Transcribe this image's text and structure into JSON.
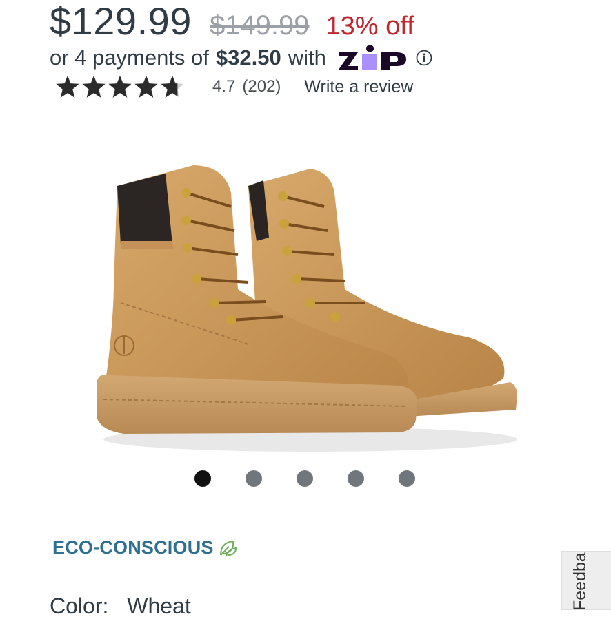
{
  "price": {
    "current": "$129.99",
    "original": "$149.99",
    "discount": "13% off"
  },
  "zip": {
    "prefix": "or 4 payments of",
    "amount": "$32.50",
    "suffix": "with",
    "logo_text": "ZIP",
    "brand_color": "#1a0826",
    "accent_color": "#aa8fff",
    "info_icon": "info-circle-icon"
  },
  "rating": {
    "stars": 4.7,
    "value": "4.7",
    "count": "(202)",
    "review_link": "Write a review"
  },
  "gallery": {
    "image_icon": "wheat-work-boots-image",
    "dot_count": 5,
    "active_index": 0
  },
  "eco": {
    "label": "ECO-CONSCIOUS",
    "icon": "leaf-icon",
    "color": "#2f6f8f"
  },
  "color": {
    "label": "Color:",
    "value": "Wheat"
  },
  "feedback": {
    "label": "Feedback"
  }
}
